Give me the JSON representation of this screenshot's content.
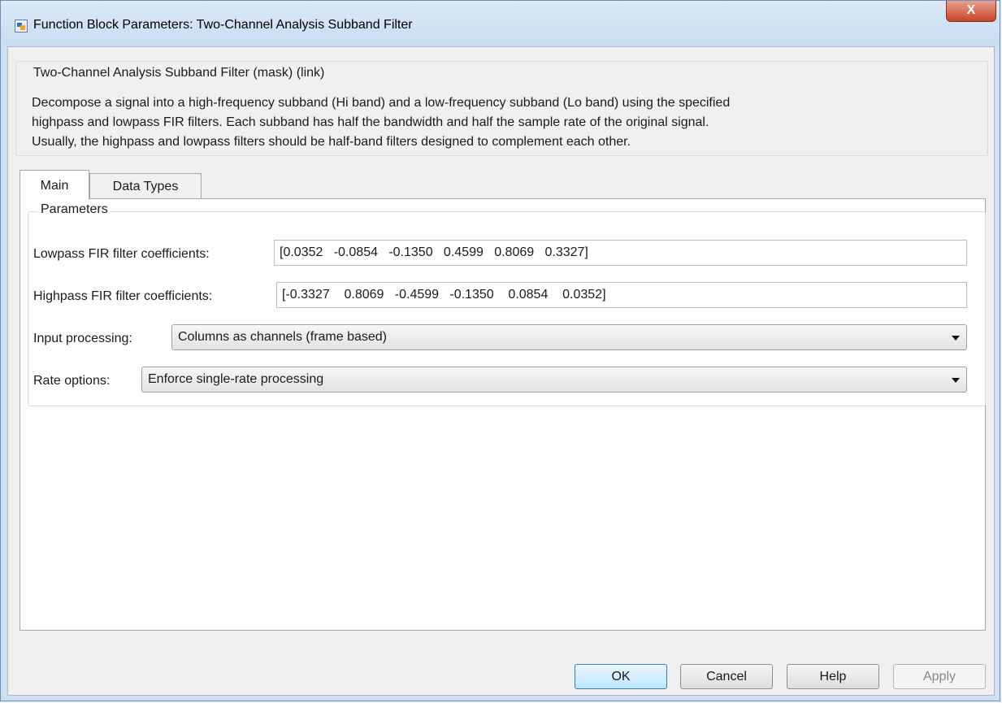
{
  "window": {
    "title": "Function Block Parameters: Two-Channel Analysis Subband Filter",
    "close_glyph": "X"
  },
  "description": {
    "legend": "Two-Channel Analysis Subband Filter (mask) (link)",
    "lines": [
      "Decompose a signal into a high-frequency subband (Hi band) and a low-frequency subband (Lo band) using the specified",
      "highpass and lowpass FIR filters. Each subband has half the bandwidth and half the sample rate of the original signal.",
      "Usually, the highpass and lowpass filters should be half-band filters designed to complement each other."
    ]
  },
  "tabs": {
    "main": "Main",
    "data_types": "Data Types",
    "active": "Main"
  },
  "parameters": {
    "legend": "Parameters",
    "lowpass": {
      "label": "Lowpass FIR filter coefficients:",
      "value": "[0.0352   -0.0854   -0.1350   0.4599   0.8069   0.3327]"
    },
    "highpass": {
      "label": "Highpass FIR filter coefficients:",
      "value": "[-0.3327    0.8069   -0.4599   -0.1350    0.0854    0.0352]"
    },
    "input_processing": {
      "label": "Input processing:",
      "selected": "Columns as channels (frame based)"
    },
    "rate_options": {
      "label": "Rate options:",
      "selected": "Enforce single-rate processing"
    }
  },
  "buttons": {
    "ok": "OK",
    "cancel": "Cancel",
    "help": "Help",
    "apply": "Apply"
  }
}
